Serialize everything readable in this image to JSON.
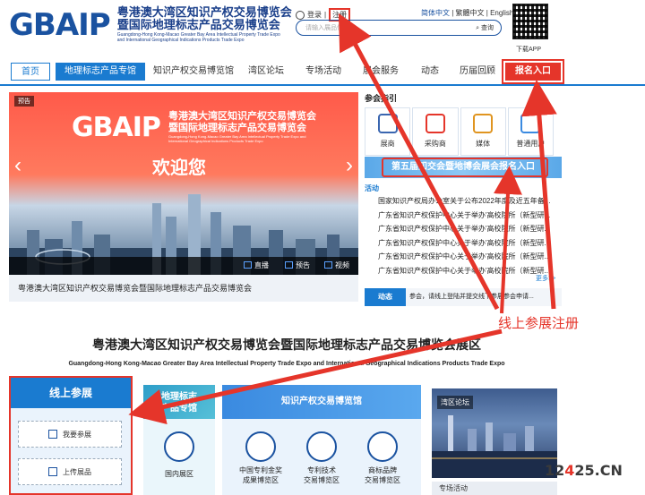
{
  "header": {
    "logo_mark": "GBAIP",
    "logo_cn_line1": "粤港澳大湾区知识产权交易博览会",
    "logo_cn_line2": "暨国际地理标志产品交易博览会",
    "logo_en": "Guangdong-Hong Kong-Macao Greater Bay Area Intellectual Property Trade Expo and International Geographical Indications Products Trade Expo",
    "login": "登录",
    "register": "注册",
    "lang_simplified": "简体中文",
    "lang_traditional": "繁體中文",
    "lang_english": "English",
    "search_placeholder": "请输入展品信息",
    "search_button": "查询",
    "qr_label": "下载APP"
  },
  "nav": {
    "items": [
      "首页",
      "地理标志产品专馆",
      "知识产权交易博览馆",
      "湾区论坛",
      "专场活动",
      "展会服务",
      "动态",
      "历届回顾",
      "报名入口"
    ]
  },
  "banner": {
    "badge": "预告",
    "logo_mark": "GBAIP",
    "cn_line1": "粤港澳大湾区知识产权交易博览会",
    "cn_line2": "暨国际地理标志产品交易博览会",
    "en_text": "Guangdong-Hong Kong-Macao Greater Bay Area Intellectual Property Trade Expo and International Geographical Indications Products Trade Expo",
    "welcome": "欢迎您",
    "arrow_left": "‹",
    "arrow_right": "›",
    "bar_live": "直播",
    "bar_preview": "预告",
    "bar_video": "视频",
    "caption": "粤港澳大湾区知识产权交易博览会暨国际地理标志产品交易博览会"
  },
  "guide": {
    "title": "参会指引",
    "icons": [
      "展商",
      "采购商",
      "媒体",
      "普通用户"
    ],
    "expo_banner": "第五届知交会暨地博会展会报名入口",
    "news_tab": "活动",
    "news": [
      "国家知识产权局办公室关于公布2022年度及近五年备...",
      "广东省知识产权保护中心关于举办'高校院所（新型研...",
      "广东省知识产权保护中心关于举办'高校院所（新型研...",
      "广东省知识产权保护中心关于举办'高校院所（新型研...",
      "广东省知识产权保护中心关于举办'高校院所（新型研...",
      "广东省知识产权保护中心关于举办'高校院所（新型研..."
    ],
    "more": "更多>>",
    "dyn_tag": "动态",
    "dyn_text": "参会，请线上登陆并提交线下参展参会申请..."
  },
  "annotation": {
    "label": "线上参展注册"
  },
  "section": {
    "title": "粤港澳大湾区知识产权交易博览会暨国际地理标志产品交易博览会展区",
    "subtitle": "Guangdong-Hong Kong-Macao Greater Bay Area Intellectual Property Trade Expo and International Geographical Indications Products Trade Expo",
    "online_head": "线上参展",
    "online_btn1": "我要参展",
    "online_btn2": "上传展品",
    "geo_head_line1": "地理标志",
    "geo_head_line2": "产品专馆",
    "geo_item": "国内展区",
    "ip_head": "知识产权交易博览馆",
    "ip_item1_line1": "中国专利金奖",
    "ip_item1_line2": "成果博览区",
    "ip_item2_line1": "专利技术",
    "ip_item2_line2": "交易博览区",
    "ip_item3_line1": "商标品牌",
    "ip_item3_line2": "交易博览区",
    "forum_tag": "湾区论坛",
    "forum2": "专场活动"
  },
  "watermark": {
    "text_a": "12",
    "text_b": "4",
    "text_c": "25.CN"
  },
  "colors": {
    "brand_blue": "#1a7bd0",
    "accent_red": "#e5352a"
  }
}
